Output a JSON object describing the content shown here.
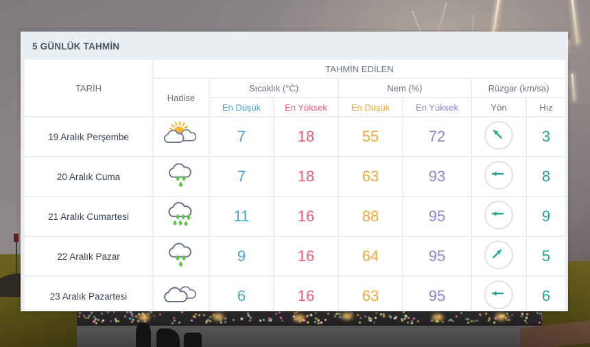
{
  "card": {
    "title": "5 GÜNLÜK TAHMİN"
  },
  "table": {
    "header": {
      "date_label": "TARİH",
      "event_label": "Hadise",
      "forecast_group": "TAHMİN EDİLEN",
      "temp_group": "Sıcaklık (°C)",
      "humidity_group": "Nem (%)",
      "wind_group": "Rüzgar (km/sa)",
      "temp_min": "En Düşük",
      "temp_max": "En Yüksek",
      "hum_min": "En Düşük",
      "hum_max": "En Yüksek",
      "wind_dir": "Yön",
      "wind_speed": "Hız"
    },
    "rows": [
      {
        "date": "19 Aralık Perşembe",
        "icon": "partly-cloudy-icon",
        "temp_min": "7",
        "temp_max": "18",
        "hum_min": "55",
        "hum_max": "72",
        "wind_dir_icon": "arrow-northwest-icon",
        "wind_speed": "3"
      },
      {
        "date": "20 Aralık Cuma",
        "icon": "rain-icon",
        "temp_min": "7",
        "temp_max": "18",
        "hum_min": "63",
        "hum_max": "93",
        "wind_dir_icon": "arrow-west-icon",
        "wind_speed": "8"
      },
      {
        "date": "21 Aralık Cumartesi",
        "icon": "heavy-rain-icon",
        "temp_min": "11",
        "temp_max": "16",
        "hum_min": "88",
        "hum_max": "95",
        "wind_dir_icon": "arrow-west-icon",
        "wind_speed": "9"
      },
      {
        "date": "22 Aralık Pazar",
        "icon": "rain-icon",
        "temp_min": "9",
        "temp_max": "16",
        "hum_min": "64",
        "hum_max": "95",
        "wind_dir_icon": "arrow-northeast-icon",
        "wind_speed": "5"
      },
      {
        "date": "23 Aralık Pazartesi",
        "icon": "cloudy-icon",
        "temp_min": "6",
        "temp_max": "16",
        "hum_min": "63",
        "hum_max": "95",
        "wind_dir_icon": "arrow-west-icon",
        "wind_speed": "6"
      }
    ]
  },
  "colors": {
    "temp_min": "#4ba3cd",
    "temp_max": "#f0607a",
    "hum_min": "#efa937",
    "hum_max": "#8b87d0",
    "wind": "#27a592",
    "card_bg": "#e9eff2",
    "cloud_outline": "#6b718a",
    "rain_drop": "#5ec64a",
    "sun": "#f7b731"
  }
}
